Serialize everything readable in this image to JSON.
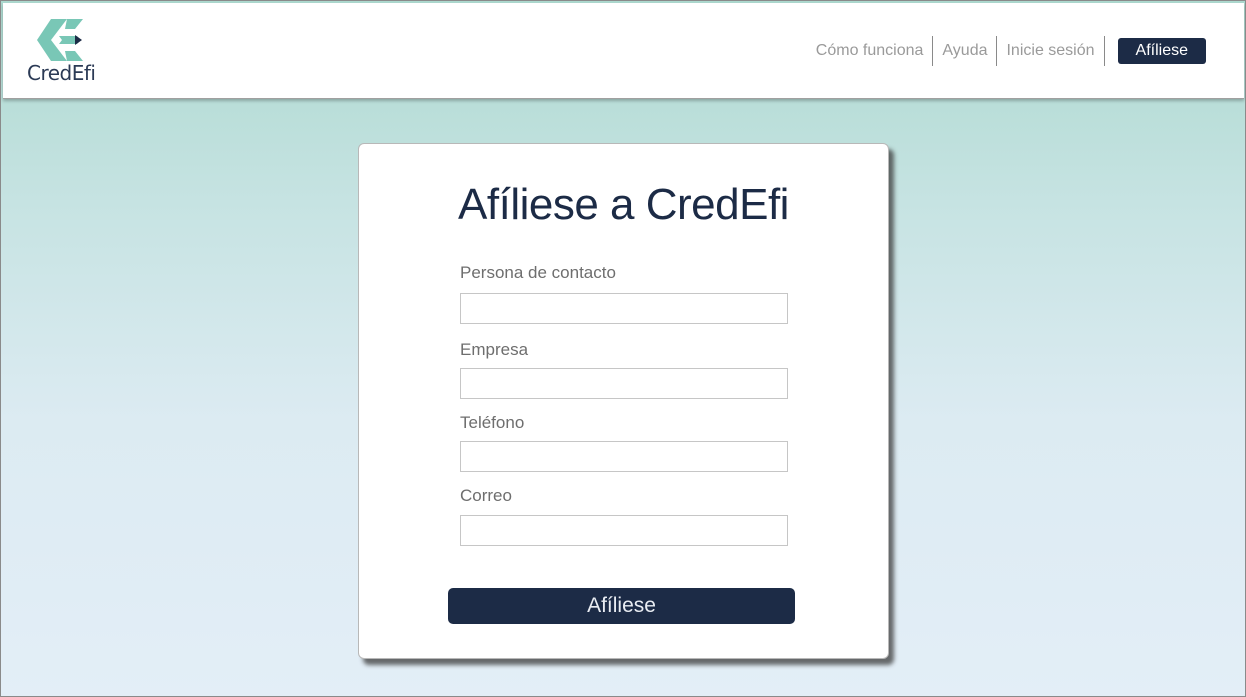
{
  "brand": {
    "name": "CredEfi",
    "logo_icon": "chevron-e-logo-icon",
    "logo_color": "#79c7b6",
    "text_color": "#2b3a55"
  },
  "nav": {
    "items": [
      {
        "label": "Cómo funciona"
      },
      {
        "label": "Ayuda"
      },
      {
        "label": "Inicie sesión"
      }
    ],
    "cta_label": "Afíliese"
  },
  "form": {
    "title": "Afíliese a CredEfi",
    "fields": [
      {
        "label": "Persona de contacto",
        "value": ""
      },
      {
        "label": "Empresa",
        "value": ""
      },
      {
        "label": "Teléfono",
        "value": ""
      },
      {
        "label": "Correo",
        "value": ""
      }
    ],
    "submit_label": "Afíliese"
  },
  "colors": {
    "primary": "#1c2b46",
    "background_top": "#acd9cf",
    "background_bottom": "#e3eef7"
  }
}
